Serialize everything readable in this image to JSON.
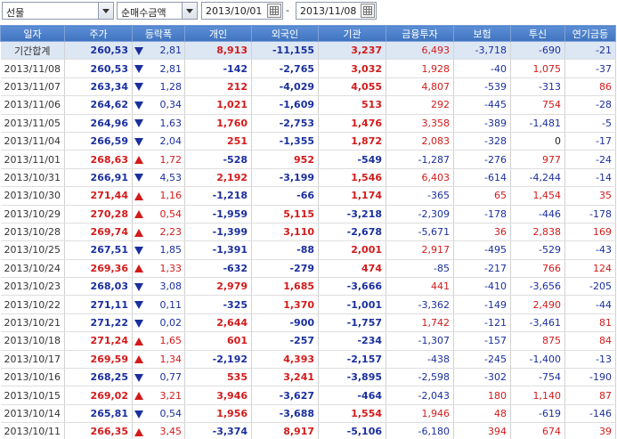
{
  "toolbar": {
    "market_select": "선물",
    "metric_select": "순매수금액",
    "date_from": "2013/10/01",
    "date_separator": "-",
    "date_to": "2013/11/08"
  },
  "colors": {
    "header": "#4a7fc9",
    "up": "#d41a1a",
    "down": "#1a2f9e",
    "total_row": "#dde7f4"
  },
  "table": {
    "columns": [
      "일자",
      "주가",
      "등락폭",
      "개인",
      "외국인",
      "기관",
      "금융투자",
      "보험",
      "투신",
      "연기금등"
    ],
    "rows": [
      {
        "date": "기간합계",
        "price": "260,53",
        "dir": "down",
        "chg": "2,81",
        "ind": "8,913",
        "frn": "-11,155",
        "inst": "3,237",
        "fin": "6,493",
        "ins": "-3,718",
        "trust": "-690",
        "pen": "-21"
      },
      {
        "date": "2013/11/08",
        "price": "260,53",
        "dir": "down",
        "chg": "2,81",
        "ind": "-142",
        "frn": "-2,765",
        "inst": "3,032",
        "fin": "1,928",
        "ins": "-40",
        "trust": "1,075",
        "pen": "-37"
      },
      {
        "date": "2013/11/07",
        "price": "263,34",
        "dir": "down",
        "chg": "1,28",
        "ind": "212",
        "frn": "-4,029",
        "inst": "4,055",
        "fin": "4,807",
        "ins": "-539",
        "trust": "-313",
        "pen": "86"
      },
      {
        "date": "2013/11/06",
        "price": "264,62",
        "dir": "down",
        "chg": "0,34",
        "ind": "1,021",
        "frn": "-1,609",
        "inst": "513",
        "fin": "292",
        "ins": "-445",
        "trust": "754",
        "pen": "-28"
      },
      {
        "date": "2013/11/05",
        "price": "264,96",
        "dir": "down",
        "chg": "1,63",
        "ind": "1,760",
        "frn": "-2,753",
        "inst": "1,476",
        "fin": "3,358",
        "ins": "-389",
        "trust": "-1,481",
        "pen": "-5"
      },
      {
        "date": "2013/11/04",
        "price": "266,59",
        "dir": "down",
        "chg": "2,04",
        "ind": "251",
        "frn": "-1,355",
        "inst": "1,872",
        "fin": "2,083",
        "ins": "-328",
        "trust": "0",
        "pen": "-17"
      },
      {
        "date": "2013/11/01",
        "price": "268,63",
        "dir": "up",
        "chg": "1,72",
        "ind": "-528",
        "frn": "952",
        "inst": "-549",
        "fin": "-1,287",
        "ins": "-276",
        "trust": "977",
        "pen": "-24"
      },
      {
        "date": "2013/10/31",
        "price": "266,91",
        "dir": "down",
        "chg": "4,53",
        "ind": "2,192",
        "frn": "-3,199",
        "inst": "1,546",
        "fin": "6,403",
        "ins": "-614",
        "trust": "-4,244",
        "pen": "-14"
      },
      {
        "date": "2013/10/30",
        "price": "271,44",
        "dir": "up",
        "chg": "1,16",
        "ind": "-1,218",
        "frn": "-66",
        "inst": "1,174",
        "fin": "-365",
        "ins": "65",
        "trust": "1,454",
        "pen": "35"
      },
      {
        "date": "2013/10/29",
        "price": "270,28",
        "dir": "up",
        "chg": "0,54",
        "ind": "-1,959",
        "frn": "5,115",
        "inst": "-3,218",
        "fin": "-2,309",
        "ins": "-178",
        "trust": "-446",
        "pen": "-178"
      },
      {
        "date": "2013/10/28",
        "price": "269,74",
        "dir": "up",
        "chg": "2,23",
        "ind": "-1,399",
        "frn": "3,110",
        "inst": "-2,678",
        "fin": "-5,671",
        "ins": "36",
        "trust": "2,838",
        "pen": "169"
      },
      {
        "date": "2013/10/25",
        "price": "267,51",
        "dir": "down",
        "chg": "1,85",
        "ind": "-1,391",
        "frn": "-88",
        "inst": "2,001",
        "fin": "2,917",
        "ins": "-495",
        "trust": "-529",
        "pen": "-43"
      },
      {
        "date": "2013/10/24",
        "price": "269,36",
        "dir": "up",
        "chg": "1,33",
        "ind": "-632",
        "frn": "-279",
        "inst": "474",
        "fin": "-85",
        "ins": "-217",
        "trust": "766",
        "pen": "124"
      },
      {
        "date": "2013/10/23",
        "price": "268,03",
        "dir": "down",
        "chg": "3,08",
        "ind": "2,979",
        "frn": "1,685",
        "inst": "-3,666",
        "fin": "441",
        "ins": "-410",
        "trust": "-3,656",
        "pen": "-205"
      },
      {
        "date": "2013/10/22",
        "price": "271,11",
        "dir": "down",
        "chg": "0,11",
        "ind": "-325",
        "frn": "1,370",
        "inst": "-1,001",
        "fin": "-3,362",
        "ins": "-149",
        "trust": "2,490",
        "pen": "-44"
      },
      {
        "date": "2013/10/21",
        "price": "271,22",
        "dir": "down",
        "chg": "0,02",
        "ind": "2,644",
        "frn": "-900",
        "inst": "-1,757",
        "fin": "1,742",
        "ins": "-121",
        "trust": "-3,461",
        "pen": "81"
      },
      {
        "date": "2013/10/18",
        "price": "271,24",
        "dir": "up",
        "chg": "1,65",
        "ind": "601",
        "frn": "-257",
        "inst": "-234",
        "fin": "-1,307",
        "ins": "-157",
        "trust": "875",
        "pen": "84"
      },
      {
        "date": "2013/10/17",
        "price": "269,59",
        "dir": "up",
        "chg": "1,34",
        "ind": "-2,192",
        "frn": "4,393",
        "inst": "-2,157",
        "fin": "-438",
        "ins": "-245",
        "trust": "-1,400",
        "pen": "-13"
      },
      {
        "date": "2013/10/16",
        "price": "268,25",
        "dir": "down",
        "chg": "0,77",
        "ind": "535",
        "frn": "3,241",
        "inst": "-3,895",
        "fin": "-2,598",
        "ins": "-302",
        "trust": "-754",
        "pen": "-190"
      },
      {
        "date": "2013/10/15",
        "price": "269,02",
        "dir": "up",
        "chg": "3,21",
        "ind": "3,946",
        "frn": "-3,627",
        "inst": "-464",
        "fin": "-2,043",
        "ins": "180",
        "trust": "1,140",
        "pen": "87"
      },
      {
        "date": "2013/10/14",
        "price": "265,81",
        "dir": "down",
        "chg": "0,54",
        "ind": "1,956",
        "frn": "-3,688",
        "inst": "1,554",
        "fin": "1,946",
        "ins": "48",
        "trust": "-619",
        "pen": "-146"
      },
      {
        "date": "2013/10/11",
        "price": "266,35",
        "dir": "up",
        "chg": "3,45",
        "ind": "-3,374",
        "frn": "8,917",
        "inst": "-5,106",
        "fin": "-6,180",
        "ins": "394",
        "trust": "674",
        "pen": "39"
      }
    ]
  }
}
